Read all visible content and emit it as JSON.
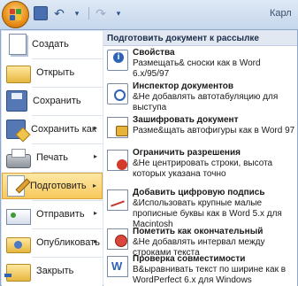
{
  "window": {
    "title_fragment": "Карл"
  },
  "left_menu": {
    "items": [
      {
        "label": "Создать",
        "icon": "new-document-icon",
        "has_submenu": false
      },
      {
        "label": "Открыть",
        "icon": "open-folder-icon",
        "has_submenu": false
      },
      {
        "label": "Сохранить",
        "icon": "save-icon",
        "has_submenu": false
      },
      {
        "label": "Сохранить как",
        "icon": "save-as-icon",
        "has_submenu": true
      },
      {
        "label": "Печать",
        "icon": "printer-icon",
        "has_submenu": true
      },
      {
        "label": "Подготовить",
        "icon": "prepare-icon",
        "has_submenu": true,
        "active": true
      },
      {
        "label": "Отправить",
        "icon": "send-icon",
        "has_submenu": true
      },
      {
        "label": "Опубликовать",
        "icon": "publish-icon",
        "has_submenu": true
      },
      {
        "label": "Закрыть",
        "icon": "close-folder-icon",
        "has_submenu": false
      }
    ],
    "arrow": "▸"
  },
  "submenu": {
    "header": "Подготовить документ к рассылке",
    "items": [
      {
        "title": "Свойства",
        "description": "Размещать& сноски как в Word 6.x/95/97",
        "icon": "properties-icon"
      },
      {
        "title": "Инспектор документов",
        "description": "&Не добавлять автотабуляцию для выступа",
        "icon": "inspect-document-icon"
      },
      {
        "title": "Зашифровать документ",
        "description": "Разме&щать автофигуры как в Word 97",
        "icon": "encrypt-lock-icon"
      },
      {
        "title": "Ограничить разрешения",
        "description": "&Не центрировать строки, высота которых указана точно",
        "icon": "restrict-permission-icon"
      },
      {
        "title": "Добавить цифровую подпись",
        "description": "&Использовать крупные малые прописные буквы как в Word 5.x для Macintosh",
        "icon": "digital-signature-icon"
      },
      {
        "title": "Пометить как окончательный",
        "description": "&Не добавлять интервал между строками текста",
        "icon": "mark-final-icon"
      },
      {
        "title": "Проверка совместимости",
        "description": "В&ыравнивать текст по ширине как в WordPerfect 6.x для Windows",
        "icon": "compatibility-check-icon"
      }
    ]
  },
  "colors": {
    "menu_background": "#dbe5f3",
    "active_highlight": "#f8c85a",
    "header_bg": "#e2e8f1"
  }
}
